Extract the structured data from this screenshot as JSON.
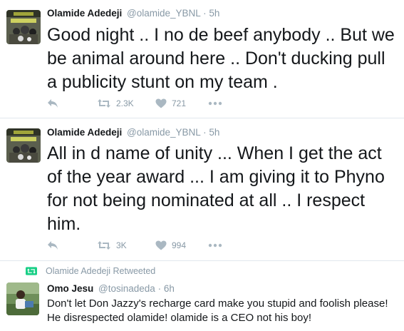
{
  "tweets": [
    {
      "name": "Olamide Adedeji",
      "handle": "@olamide_YBNL",
      "dot": "·",
      "time": "5h",
      "text": "Good night .. I no de beef anybody .. But we be animal around here .. Don't ducking pull a publicity stunt on my team .",
      "retweets": "2.3K",
      "likes": "721"
    },
    {
      "name": "Olamide Adedeji",
      "handle": "@olamide_YBNL",
      "dot": "·",
      "time": "5h",
      "text": "All in d name of unity ... When I get the act of the year award ... I am giving it to Phyno for not being nominated at all .. I respect him.",
      "retweets": "3K",
      "likes": "994"
    },
    {
      "retweeted_by": "Olamide Adedeji Retweeted",
      "name": "Omo Jesu",
      "handle": "@tosinadeda",
      "dot": "·",
      "time": "6h",
      "text": "Don't let Don Jazzy's recharge card make you stupid and foolish please! He disrespected olamide! olamide is a CEO not his boy!"
    }
  ],
  "icons": {
    "reply": "reply-icon",
    "retweet": "retweet-icon",
    "like": "heart-icon",
    "more": "more-dots-icon"
  },
  "colors": {
    "icon_gray": "#aab8c2",
    "retweet_green": "#19cf86",
    "text": "#14171a",
    "meta": "#8899a6"
  }
}
